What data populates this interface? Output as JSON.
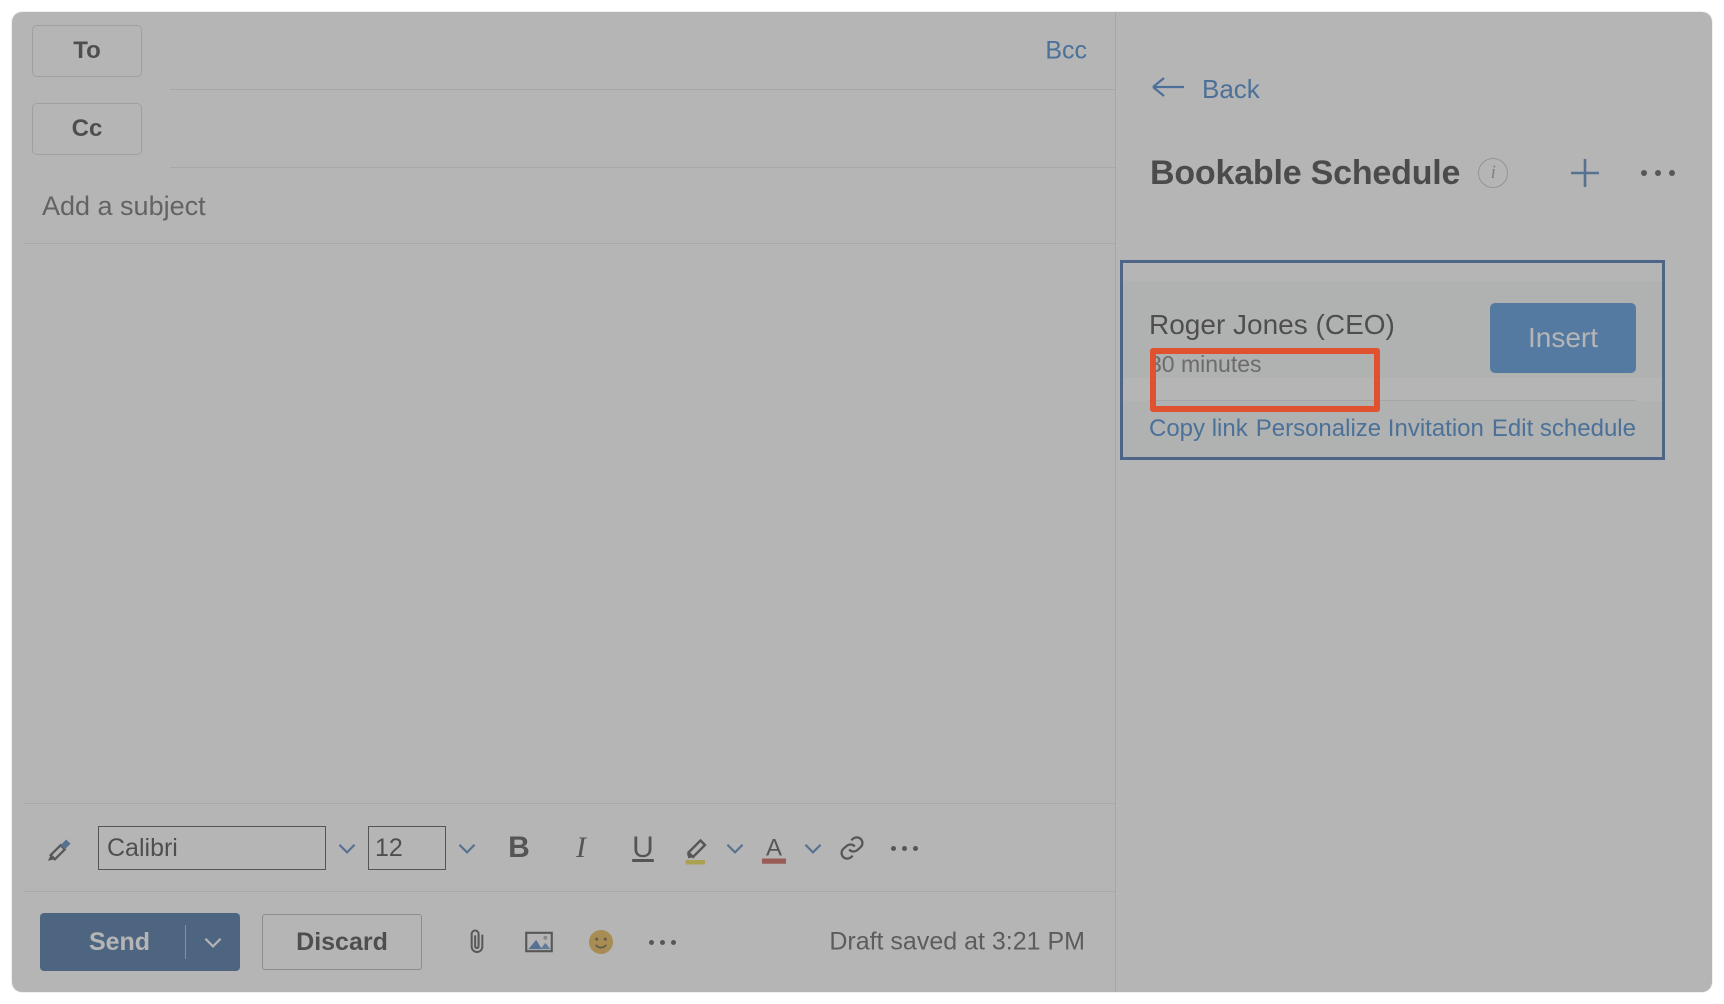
{
  "compose": {
    "to_label": "To",
    "cc_label": "Cc",
    "bcc_label": "Bcc",
    "subject_placeholder": "Add a subject",
    "to_value": "",
    "cc_value": "",
    "format_bar": {
      "format_painter_icon": "format-painter-icon",
      "font_family_value": "Calibri",
      "font_size_value": "12",
      "bold_label": "B",
      "italic_label": "I",
      "underline_label": "U",
      "highlight_icon": "highlighter-icon",
      "font_color_label": "A",
      "link_icon": "link-icon",
      "more_label": "more-formatting-options"
    },
    "send_bar": {
      "send_label": "Send",
      "discard_label": "Discard",
      "attach_icon": "paperclip-icon",
      "image_icon": "picture-icon",
      "emoji_icon": "emoji-icon",
      "more_icon": "more-options-icon",
      "draft_status": "Draft saved at 3:21 PM"
    }
  },
  "panel": {
    "back_label": "Back",
    "title": "Bookable Schedule",
    "info_icon_label": "i",
    "add_icon": "plus-icon",
    "more_icon": "more-options-icon",
    "card": {
      "name": "Roger Jones (CEO)",
      "duration": "30 minutes",
      "insert_label": "Insert",
      "actions": [
        {
          "label": "Copy link",
          "name": "copy-link"
        },
        {
          "label": "Personalize Invitation",
          "name": "personalize-invitation"
        },
        {
          "label": "Edit schedule",
          "name": "edit-schedule"
        }
      ]
    }
  },
  "colors": {
    "link_blue": "#1668c1",
    "insert_blue": "#2b7cd3",
    "send_blue": "#1a4f8a",
    "card_border_blue": "#1a4f9c",
    "highlight_orange": "#e0512f",
    "card_bg": "#f4f5f7"
  }
}
